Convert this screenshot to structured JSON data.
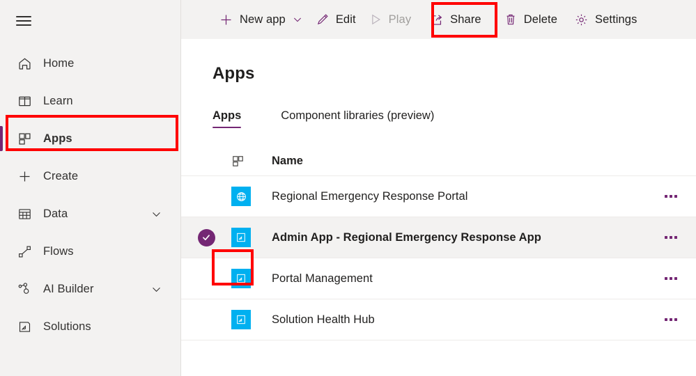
{
  "sidebar": {
    "menu_button": "hamburger-menu",
    "items": [
      {
        "label": "Home",
        "icon": "home-icon",
        "has_chevron": false,
        "selected": false
      },
      {
        "label": "Learn",
        "icon": "book-icon",
        "has_chevron": false,
        "selected": false
      },
      {
        "label": "Apps",
        "icon": "apps-grid-icon",
        "has_chevron": false,
        "selected": true
      },
      {
        "label": "Create",
        "icon": "plus-icon",
        "has_chevron": false,
        "selected": false
      },
      {
        "label": "Data",
        "icon": "table-icon",
        "has_chevron": true,
        "selected": false
      },
      {
        "label": "Flows",
        "icon": "flows-icon",
        "has_chevron": false,
        "selected": false
      },
      {
        "label": "AI Builder",
        "icon": "ai-builder-icon",
        "has_chevron": true,
        "selected": false
      },
      {
        "label": "Solutions",
        "icon": "solutions-icon",
        "has_chevron": false,
        "selected": false
      }
    ]
  },
  "command_bar": {
    "new_app": {
      "label": "New app",
      "icon": "plus-icon",
      "caret": "chevron-down-icon"
    },
    "edit": {
      "label": "Edit",
      "icon": "pencil-icon"
    },
    "play": {
      "label": "Play",
      "icon": "play-triangle-icon",
      "disabled": true
    },
    "share": {
      "label": "Share",
      "icon": "share-icon",
      "highlighted": true
    },
    "delete": {
      "label": "Delete",
      "icon": "trash-icon"
    },
    "settings": {
      "label": "Settings",
      "icon": "gear-icon"
    }
  },
  "main": {
    "page_title": "Apps",
    "tabs": [
      {
        "label": "Apps",
        "active": true
      },
      {
        "label": "Component libraries (preview)",
        "active": false
      }
    ],
    "table": {
      "header": {
        "icon": "apps-grid-icon",
        "name": "Name"
      },
      "rows": [
        {
          "name": "Regional Emergency Response Portal",
          "icon": "globe-tile-icon",
          "selected": false,
          "more": "more-options-icon"
        },
        {
          "name": "Admin App - Regional Emergency Response App",
          "icon": "model-app-tile-icon",
          "selected": true,
          "more": "more-options-icon"
        },
        {
          "name": "Portal Management",
          "icon": "model-app-tile-icon",
          "selected": false,
          "more": "more-options-icon"
        },
        {
          "name": "Solution Health Hub",
          "icon": "model-app-tile-icon",
          "selected": false,
          "more": "more-options-icon"
        }
      ]
    }
  },
  "colors": {
    "accent_purple": "#742774",
    "tile_blue": "#00b0f0",
    "annotation_red": "#ff0000",
    "sidebar_bg": "#f3f2f1",
    "selected_row_bg": "#f3f2f1"
  }
}
